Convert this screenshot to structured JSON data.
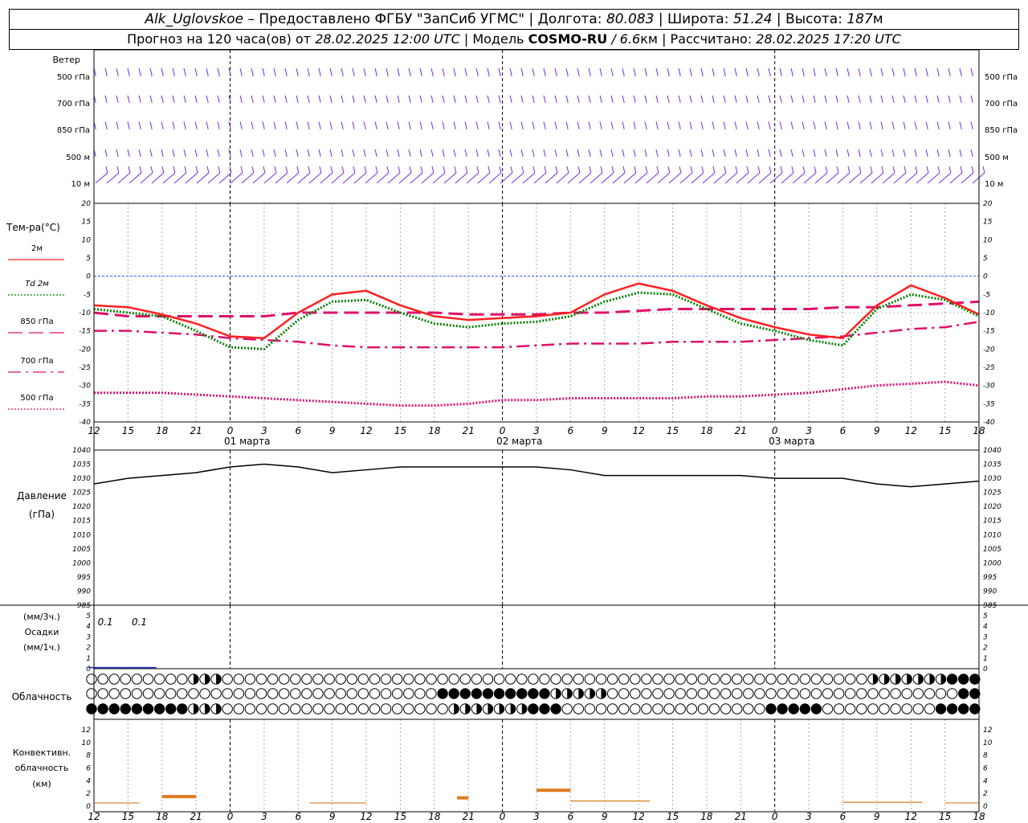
{
  "header": {
    "station": "Alk_Uglovskoe",
    "provider": "– Предоставлено ФГБУ \"ЗапСиб УГМС\"",
    "lon_label": "| Долгота:",
    "lon": "80.083",
    "lat_label": "| Широта:",
    "lat": "51.24",
    "alt_label": "| Высота:",
    "alt": "187",
    "alt_unit": "м",
    "forecast_label": "Прогноз на 120 часа(ов) от",
    "forecast_time": "28.02.2025 12:00 UTC",
    "model_label": "| Модель",
    "model": "COSMO-RU",
    "resolution": "/ 6.6",
    "res_unit": "км",
    "computed_label": "| Рассчитано:",
    "computed_time": "28.02.2025 17:20 UTC"
  },
  "wind": {
    "title": "Ветер",
    "levels": [
      "500 гПа",
      "700 гПа",
      "850 гПа",
      "500 м",
      "10 м"
    ]
  },
  "temp_panel": {
    "title": "Тем-ра(°C)",
    "legend": [
      {
        "label": "2м",
        "color": "#ff2020",
        "style": "solid"
      },
      {
        "label": "Td  2м",
        "color": "#008000",
        "style": "dotted"
      },
      {
        "label": "850 гПа",
        "color": "#e0106a",
        "style": "dashed"
      },
      {
        "label": "700 гПа",
        "color": "#e0106a",
        "style": "dashdot"
      },
      {
        "label": "500 гПа",
        "color": "#e0106a",
        "style": "dotted"
      }
    ]
  },
  "pressure_panel": {
    "title": "Давление",
    "unit": "(гПа)"
  },
  "precip_panel": {
    "unit_top": "(мм/3ч.)",
    "title": "Осадки",
    "unit_bottom": "(мм/1ч.)",
    "labels": [
      "0.1",
      "0.1"
    ]
  },
  "cloud_panel": {
    "title": "Облачность"
  },
  "conv_panel": {
    "title1": "Конвективн.",
    "title2": "облачность",
    "unit": "(км)"
  },
  "time_axis": {
    "hour_labels": [
      "12",
      "15",
      "18",
      "21",
      "0",
      "3",
      "6",
      "9",
      "12",
      "15",
      "18",
      "21",
      "0",
      "3",
      "6",
      "9",
      "12",
      "15",
      "18",
      "21",
      "0",
      "3",
      "6",
      "9",
      "12",
      "15",
      "18"
    ],
    "day_labels": [
      "01 марта",
      "02 марта",
      "03 марта"
    ]
  },
  "chart_data": [
    {
      "type": "line",
      "id": "temperature",
      "x_hours": [
        0,
        3,
        6,
        9,
        12,
        15,
        18,
        21,
        24,
        27,
        30,
        33,
        36,
        39,
        42,
        45,
        48,
        51,
        54,
        57,
        60,
        63,
        66,
        69,
        72,
        75,
        78
      ],
      "ylim": [
        -40,
        20
      ],
      "yticks": [
        20,
        15,
        10,
        5,
        0,
        -5,
        -10,
        -15,
        -20,
        -25,
        -30,
        -35,
        -40
      ],
      "series": [
        {
          "name": "2м",
          "values": [
            -8,
            -8.5,
            -10.5,
            -13,
            -16.5,
            -17,
            -10,
            -5,
            -4,
            -8,
            -11,
            -12,
            -11.5,
            -11,
            -10,
            -5,
            -2,
            -4,
            -8,
            -11.5,
            -14,
            -16,
            -17,
            -8,
            -2.5,
            -6,
            -10.5
          ]
        },
        {
          "name": "Td 2м",
          "values": [
            -9,
            -10,
            -11,
            -15,
            -19.5,
            -20,
            -12,
            -7,
            -6.5,
            -10,
            -13,
            -14,
            -13,
            -12.5,
            -11,
            -7,
            -4.5,
            -5,
            -9,
            -13,
            -15,
            -17.5,
            -19,
            -9,
            -5,
            -6.5,
            -11
          ]
        },
        {
          "name": "850 гПа",
          "values": [
            -10,
            -11,
            -11,
            -11,
            -11,
            -11,
            -10,
            -10,
            -10,
            -10,
            -10,
            -10.5,
            -10.5,
            -10.5,
            -10,
            -10,
            -9.5,
            -9,
            -9,
            -9,
            -9,
            -9,
            -8.5,
            -8.5,
            -8,
            -7.5,
            -7
          ]
        },
        {
          "name": "700 гПа",
          "values": [
            -15,
            -15,
            -15.5,
            -16,
            -17,
            -17.5,
            -18,
            -19,
            -19.5,
            -19.5,
            -19.5,
            -19.5,
            -19.5,
            -19,
            -18.5,
            -18.5,
            -18.5,
            -18,
            -18,
            -18,
            -17.5,
            -17,
            -16.5,
            -15.5,
            -14.5,
            -14,
            -12.5
          ]
        },
        {
          "name": "500 гПа",
          "values": [
            -32,
            -32,
            -32,
            -32.5,
            -33,
            -33.5,
            -34,
            -34.5,
            -35,
            -35.5,
            -35.5,
            -35,
            -34,
            -34,
            -33.5,
            -33.5,
            -33.5,
            -33.5,
            -33,
            -33,
            -32.5,
            -32,
            -31,
            -30,
            -29.5,
            -29,
            -30
          ]
        }
      ]
    },
    {
      "type": "line",
      "id": "pressure",
      "x_hours": [
        0,
        3,
        6,
        9,
        12,
        15,
        18,
        21,
        24,
        27,
        30,
        33,
        36,
        39,
        42,
        45,
        48,
        51,
        54,
        57,
        60,
        63,
        66,
        69,
        72,
        75,
        78
      ],
      "ylim": [
        985,
        1040
      ],
      "yticks": [
        1040,
        1035,
        1030,
        1025,
        1020,
        1015,
        1010,
        1005,
        1000,
        995,
        990,
        985
      ],
      "series": [
        {
          "name": "",
          "values": [
            1028,
            1030,
            1031,
            1032,
            1034,
            1035,
            1034,
            1032,
            1033,
            1034,
            1034,
            1034,
            1034,
            1034,
            1033,
            1031,
            1031,
            1031,
            1031,
            1031,
            1030,
            1030,
            1030,
            1028,
            1027,
            1028,
            1029
          ]
        }
      ]
    },
    {
      "type": "bar",
      "id": "precip",
      "ylim": [
        0,
        5
      ],
      "yticks": [
        5,
        4,
        3,
        2,
        1,
        0
      ],
      "values": [
        {
          "x_hours": 1,
          "value": 0.1
        },
        {
          "x_hours": 4,
          "value": 0.1
        }
      ]
    },
    {
      "type": "bar",
      "id": "convective_cloud",
      "ylim": [
        0,
        13
      ],
      "yticks": [
        12,
        10,
        8,
        6,
        4,
        2,
        0
      ],
      "segments": [
        {
          "x_from": 0,
          "x_to": 4,
          "value": 0.5
        },
        {
          "x_from": 6,
          "x_to": 9,
          "value": 1.5
        },
        {
          "x_from": 19,
          "x_to": 24,
          "value": 0.5
        },
        {
          "x_from": 32,
          "x_to": 33,
          "value": 1.3
        },
        {
          "x_from": 39,
          "x_to": 42,
          "value": 2.5
        },
        {
          "x_from": 42,
          "x_to": 49,
          "value": 0.8
        },
        {
          "x_from": 66,
          "x_to": 73,
          "value": 0.6
        },
        {
          "x_from": 75,
          "x_to": 78,
          "value": 0.5
        }
      ]
    }
  ]
}
